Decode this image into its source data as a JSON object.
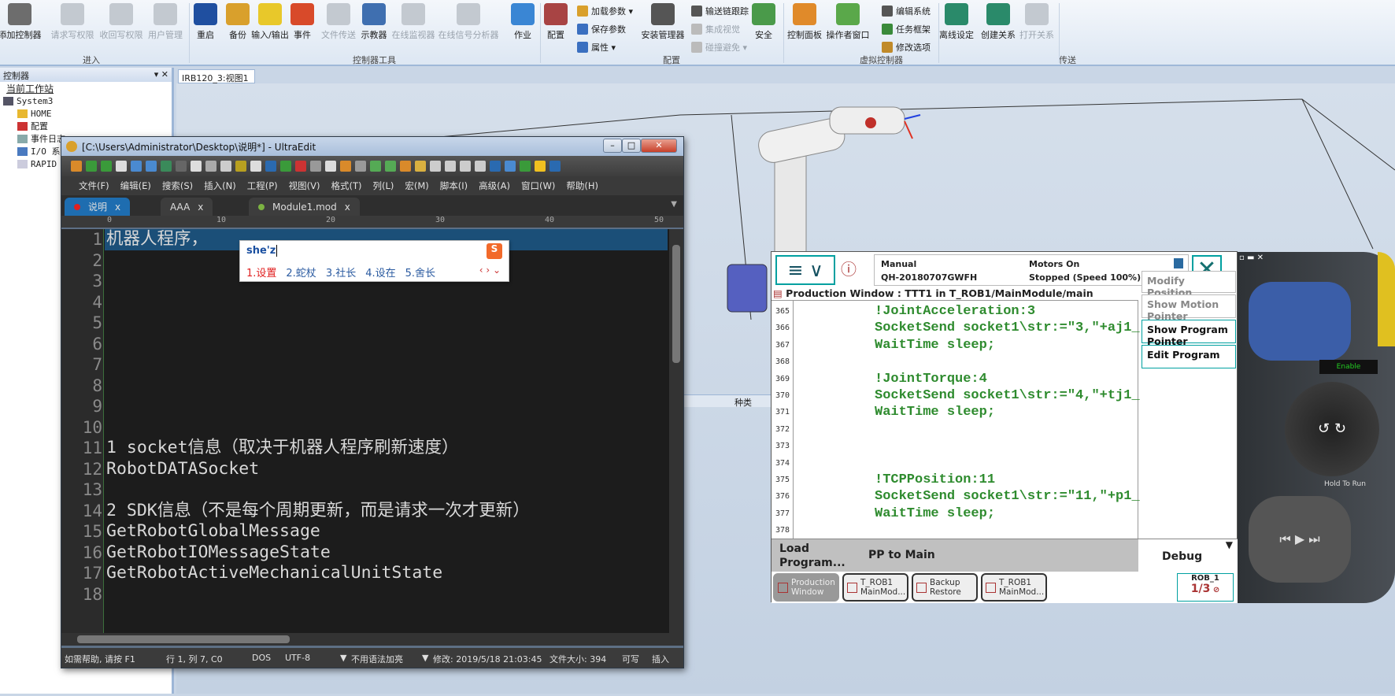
{
  "ribbon": {
    "buttons": [
      {
        "label": "添加控制器",
        "icon": "add-controller-icon",
        "disabled": false,
        "color": "#6d6d6d"
      },
      {
        "label": "请求写权限",
        "icon": "request-write-icon",
        "disabled": true
      },
      {
        "label": "收回写权限",
        "icon": "release-write-icon",
        "disabled": true
      },
      {
        "label": "用户管理",
        "icon": "user-management-icon",
        "disabled": true
      },
      {
        "label": "重启",
        "icon": "restart-icon",
        "disabled": false,
        "color": "#1f4fa0"
      },
      {
        "label": "备份",
        "icon": "backup-icon",
        "disabled": false,
        "color": "#d9a02c"
      },
      {
        "label": "输入/输出",
        "icon": "io-icon",
        "disabled": false,
        "color": "#e8c82a"
      },
      {
        "label": "事件",
        "icon": "event-icon",
        "disabled": false,
        "color": "#d84a2a"
      },
      {
        "label": "文件传送",
        "icon": "file-transfer-icon",
        "disabled": true
      },
      {
        "label": "示教器",
        "icon": "flexpendant-icon",
        "disabled": false,
        "color": "#3f6fb0"
      },
      {
        "label": "在线监视器",
        "icon": "online-monitor-icon",
        "disabled": true
      },
      {
        "label": "在线信号分析器",
        "icon": "signal-analyzer-icon",
        "disabled": true
      },
      {
        "label": "作业",
        "icon": "job-icon",
        "disabled": false,
        "color": "#3a86d4"
      },
      {
        "label": "配置",
        "icon": "configuration-icon",
        "disabled": false,
        "color": "#a84444"
      },
      {
        "label": "安装管理器",
        "icon": "installation-manager-icon",
        "disabled": false,
        "color": "#555"
      },
      {
        "label": "安全",
        "icon": "safety-icon",
        "disabled": false,
        "color": "#4a9a4a"
      },
      {
        "label": "控制面板",
        "icon": "control-panel-icon",
        "disabled": false,
        "color": "#e08a2a"
      },
      {
        "label": "操作者窗口",
        "icon": "operator-window-icon",
        "disabled": false,
        "color": "#5aa84a"
      },
      {
        "label": "离线设定",
        "icon": "offline-settings-icon",
        "disabled": false,
        "color": "#2a8a6a"
      },
      {
        "label": "创建关系",
        "icon": "create-relation-icon",
        "disabled": false,
        "color": "#2a8a6a"
      },
      {
        "label": "打开关系",
        "icon": "open-relation-icon",
        "disabled": true
      }
    ],
    "small": [
      {
        "label": "加载参数 ▾",
        "icon": "load-parameters-icon",
        "disabled": false,
        "color": "#d9a02c"
      },
      {
        "label": "保存参数",
        "icon": "save-parameters-icon",
        "disabled": false,
        "color": "#3a6fc0"
      },
      {
        "label": "属性 ▾",
        "icon": "properties-icon",
        "disabled": false,
        "color": "#3a6fc0"
      },
      {
        "label": "输送链跟踪",
        "icon": "conveyor-tracking-icon",
        "disabled": false,
        "color": "#555"
      },
      {
        "label": "集成视觉",
        "icon": "integrated-vision-icon",
        "disabled": true
      },
      {
        "label": "碰撞避免 ▾",
        "icon": "collision-avoidance-icon",
        "disabled": true
      },
      {
        "label": "编辑系统",
        "icon": "edit-system-icon",
        "disabled": false,
        "color": "#555"
      },
      {
        "label": "任务框架",
        "icon": "task-frame-icon",
        "disabled": false,
        "color": "#3a8a3a"
      },
      {
        "label": "修改选项",
        "icon": "modify-options-icon",
        "disabled": false,
        "color": "#c08a2a"
      }
    ],
    "groups": [
      "进入",
      "控制器工具",
      "配置",
      "虚拟控制器",
      "传送"
    ]
  },
  "left_panel": {
    "title": "控制器",
    "tree": [
      {
        "label": "当前工作站",
        "icon": ""
      },
      {
        "label": "System3",
        "icon": "controller-icon"
      },
      {
        "label": "HOME",
        "icon": "folder-icon"
      },
      {
        "label": "配置",
        "icon": "configuration-icon"
      },
      {
        "label": "事件日志",
        "icon": "event-log-icon"
      },
      {
        "label": "I/O 系统",
        "icon": "io-system-icon"
      },
      {
        "label": "RAPID",
        "icon": "rapid-icon"
      }
    ]
  },
  "view": {
    "tab": "IRB120_3:视图1",
    "bottom_header": "种类"
  },
  "ultraedit": {
    "title": "[C:\\Users\\Administrator\\Desktop\\说明*] - UltraEdit",
    "menu": [
      "文件(F)",
      "编辑(E)",
      "搜索(S)",
      "插入(N)",
      "工程(P)",
      "视图(V)",
      "格式(T)",
      "列(L)",
      "宏(M)",
      "脚本(I)",
      "高级(A)",
      "窗口(W)",
      "帮助(H)"
    ],
    "tabs": [
      {
        "label": "说明",
        "active": true,
        "dot": "#e02020"
      },
      {
        "label": "AAA",
        "active": false
      },
      {
        "label": "Module1.mod",
        "active": false,
        "dot": "#7cb342"
      }
    ],
    "ruler": [
      "0",
      "10",
      "20",
      "30",
      "40",
      "50"
    ],
    "lines": [
      "机器人程序，",
      "",
      "",
      "",
      "",
      "",
      "",
      "",
      "",
      "",
      "1 socket信息（取决于机器人程序刷新速度）",
      "RobotDATASocket",
      "",
      "2 SDK信息（不是每个周期更新，而是请求一次才更新）",
      "GetRobotGlobalMessage",
      "GetRobotIOMessageState",
      "GetRobotActiveMechanicalUnitState",
      ""
    ],
    "status": {
      "help": "如需帮助, 请按 F1",
      "position": "行 1, 列 7, C0",
      "line_ending": "DOS",
      "encoding": "UTF-8",
      "syntax": "不用语法加亮",
      "modified": "修改: 2019/5/18 21:03:45",
      "size": "文件大小: 394",
      "mode": "可写",
      "insert": "插入"
    }
  },
  "ime": {
    "input": "she'z",
    "candidates": [
      "1.设置",
      "2.蛇杖",
      "3.社长",
      "4.设在",
      "5.舍长"
    ],
    "logo": "S"
  },
  "pendant": {
    "mode": "Manual",
    "system": "QH-20180707GWFH",
    "motors": "Motors On",
    "state": "Stopped (Speed 100%)",
    "window_title": "Production Window : TTT1 in T_ROB1/MainModule/main",
    "code": [
      {
        "n": "365",
        "t": "!JointAcceleration:3"
      },
      {
        "n": "366",
        "t": "SocketSend socket1\\str:=\"3,\"+aj1_"
      },
      {
        "n": "367",
        "t": "WaitTime sleep;"
      },
      {
        "n": "368",
        "t": ""
      },
      {
        "n": "369",
        "t": "!JointTorque:4"
      },
      {
        "n": "370",
        "t": "SocketSend socket1\\str:=\"4,\"+tj1_"
      },
      {
        "n": "371",
        "t": "WaitTime sleep;"
      },
      {
        "n": "372",
        "t": ""
      },
      {
        "n": "373",
        "t": ""
      },
      {
        "n": "374",
        "t": ""
      },
      {
        "n": "375",
        "t": "!TCPPosition:11"
      },
      {
        "n": "376",
        "t": "SocketSend socket1\\str:=\"11,\"+p1_"
      },
      {
        "n": "377",
        "t": "WaitTime sleep;"
      },
      {
        "n": "378",
        "t": ""
      }
    ],
    "side_buttons": [
      {
        "label": "Modify Position",
        "disabled": true
      },
      {
        "label": "Show Motion Pointer",
        "disabled": true
      },
      {
        "label": "Show Program Pointer",
        "disabled": false
      },
      {
        "label": "Edit Program",
        "disabled": false
      }
    ],
    "bottom": {
      "load": "Load Program...",
      "pp": "PP to Main",
      "debug": "Debug"
    },
    "taskbar": [
      {
        "l1": "Production",
        "l2": "Window"
      },
      {
        "l1": "T_ROB1",
        "l2": "MainMod..."
      },
      {
        "l1": "Backup",
        "l2": "Restore"
      },
      {
        "l1": "T_ROB1",
        "l2": "MainMod..."
      }
    ],
    "rob": {
      "name": "ROB_1",
      "fraction": "1/3"
    },
    "hardware": {
      "enable": "Enable",
      "hold": "Hold To Run"
    }
  },
  "colors": {
    "accent": "#00a0a0",
    "code_green": "#2e8b2e",
    "editor_bg": "#1c1c1c"
  }
}
